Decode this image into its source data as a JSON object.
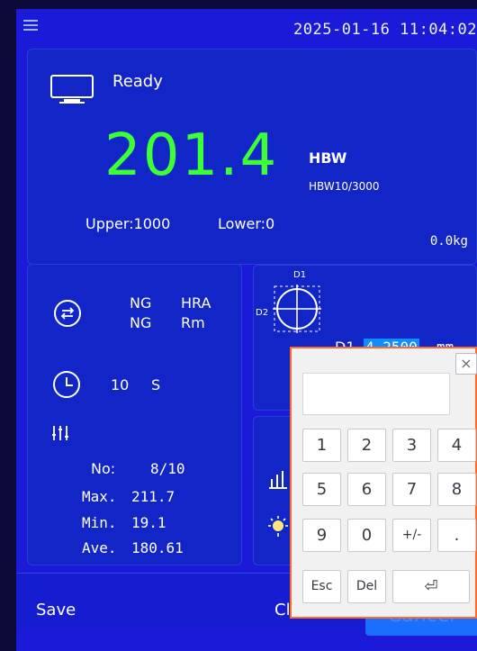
{
  "header": {
    "datetime": "2025-01-16  11:04:02"
  },
  "main": {
    "status": "Ready",
    "hardness_value": "201.4",
    "unit": "HBW",
    "method": "HBW10/3000",
    "upper_limit": "Upper:1000",
    "lower_limit": "Lower:0",
    "load": "0.0kg"
  },
  "left_panel": {
    "ng_top_left": "NG",
    "ng_bottom_left": "NG",
    "scale_1": "HRA",
    "scale_2": "Rm",
    "time_value": "10",
    "time_unit": "S",
    "no_label": "No:",
    "no_value": "8/10",
    "max_label": "Max.",
    "max_value": "211.7",
    "min_label": "Min.",
    "min_value": "19.1",
    "ave_label": "Ave.",
    "ave_value": "180.61"
  },
  "diagram": {
    "d1_top_label": "D1",
    "d2_side_label": "D2",
    "d1_value_label": "D1",
    "d1_value": "4.2500",
    "d1_unit": "mm"
  },
  "bottom_bar": {
    "save": "Save",
    "clear": "Cle...",
    "cancel": "Cancel"
  },
  "keypad": {
    "keys_row1": [
      "1",
      "2",
      "3",
      "4"
    ],
    "keys_row2": [
      "5",
      "6",
      "7",
      "8"
    ],
    "keys_row3": [
      "9",
      "0",
      "+/-",
      "."
    ],
    "esc": "Esc",
    "del": "Del",
    "enter": "⏎",
    "close": "×"
  }
}
